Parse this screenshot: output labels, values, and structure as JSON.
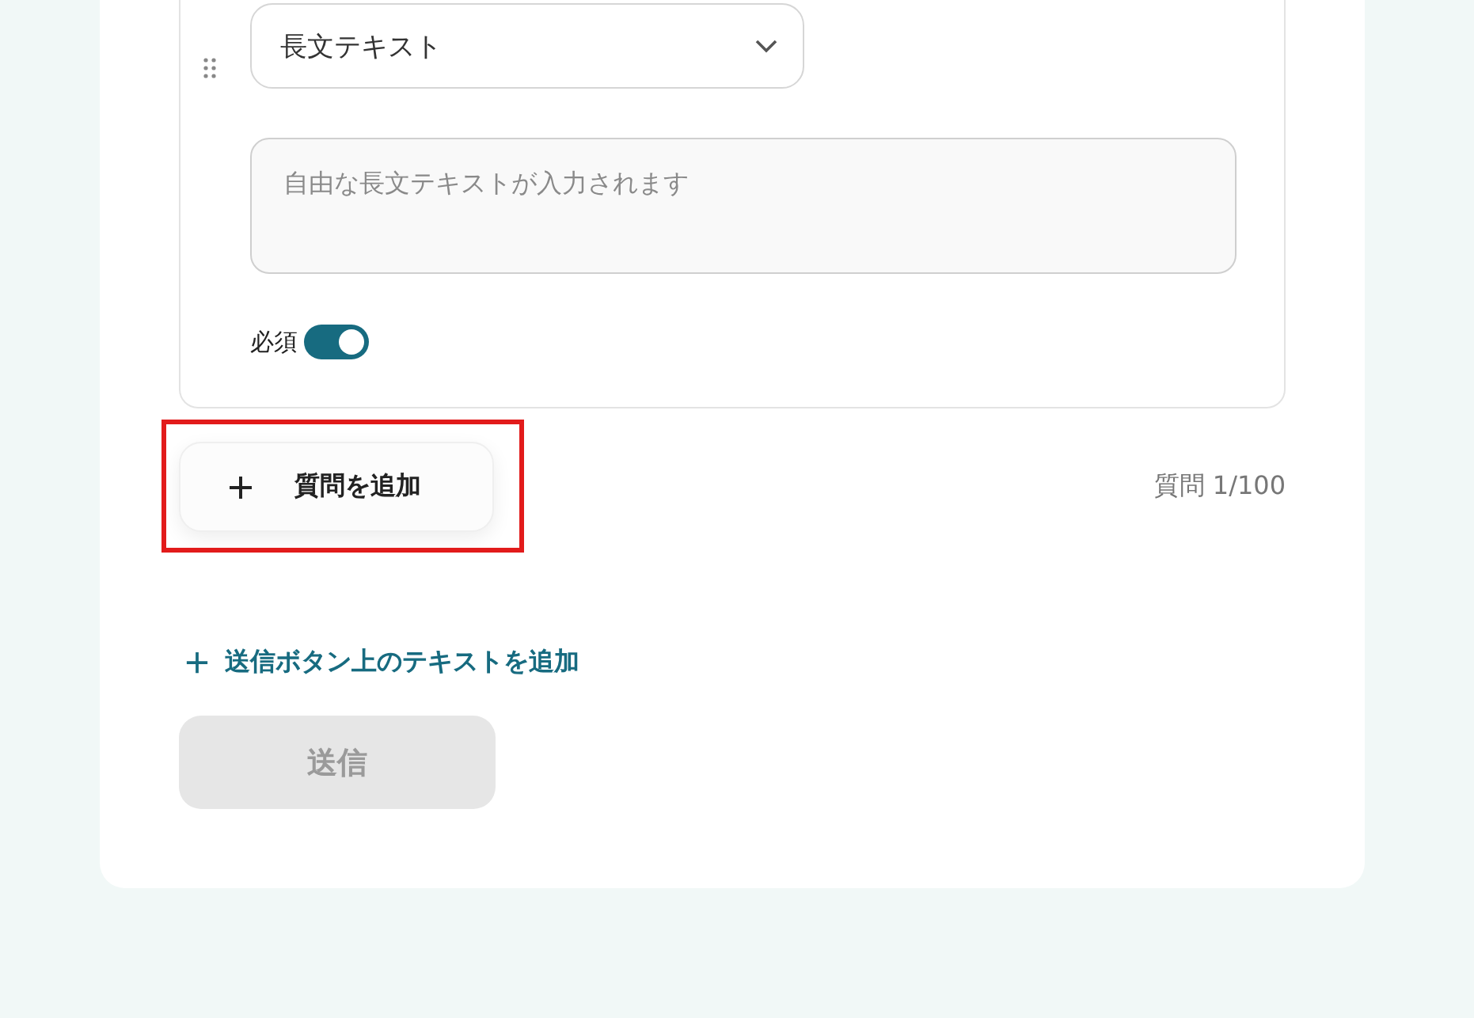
{
  "question": {
    "type_select": {
      "value": "長文テキスト"
    },
    "answer_field": {
      "placeholder": "自由な長文テキストが入力されます"
    },
    "required": {
      "label": "必須",
      "on": true
    }
  },
  "add_question": {
    "label": "質問を追加",
    "highlighted": true
  },
  "question_count": "質問 1/100",
  "add_text_link": {
    "label": "送信ボタン上のテキストを追加"
  },
  "submit": {
    "label": "送信",
    "disabled": true
  }
}
